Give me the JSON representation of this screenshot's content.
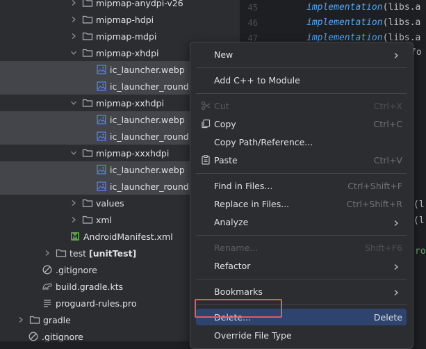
{
  "tree": {
    "rows": [
      {
        "label": "mipmap-anydpi-v26",
        "type": "folder",
        "expanded": false
      },
      {
        "label": "mipmap-hdpi",
        "type": "folder",
        "expanded": false
      },
      {
        "label": "mipmap-mdpi",
        "type": "folder",
        "expanded": false
      },
      {
        "label": "mipmap-xhdpi",
        "type": "folder",
        "expanded": true
      },
      {
        "label": "ic_launcher.webp",
        "type": "image",
        "selected": true
      },
      {
        "label": "ic_launcher_round.webp",
        "type": "image",
        "selected": true
      },
      {
        "label": "mipmap-xxhdpi",
        "type": "folder",
        "expanded": true
      },
      {
        "label": "ic_launcher.webp",
        "type": "image",
        "selected": true
      },
      {
        "label": "ic_launcher_round.webp",
        "type": "image",
        "selected": true
      },
      {
        "label": "mipmap-xxxhdpi",
        "type": "folder",
        "expanded": true
      },
      {
        "label": "ic_launcher.webp",
        "type": "image",
        "selected": true
      },
      {
        "label": "ic_launcher_round.webp",
        "type": "image",
        "selected": true
      },
      {
        "label": "values",
        "type": "folder",
        "expanded": false
      },
      {
        "label": "xml",
        "type": "folder",
        "expanded": false
      },
      {
        "label": "AndroidManifest.xml",
        "type": "manifest"
      },
      {
        "label": "test",
        "suffix": "[unitTest]",
        "type": "folder",
        "expanded": false
      },
      {
        "label": ".gitignore",
        "type": "ignore"
      },
      {
        "label": "build.gradle.kts",
        "type": "gradle"
      },
      {
        "label": "proguard-rules.pro",
        "type": "text"
      },
      {
        "label": "gradle",
        "type": "folder",
        "expanded": false
      },
      {
        "label": ".gitignore",
        "type": "ignore"
      }
    ]
  },
  "editor": {
    "line_numbers": [
      "45",
      "46",
      "47"
    ],
    "lines": [
      {
        "keyword": "implementation",
        "text": "(libs.a"
      },
      {
        "keyword": "implementation",
        "text": "(libs.a"
      },
      {
        "keyword": "implementation",
        "text": "(libs.a"
      }
    ],
    "fragments": [
      "fo",
      "(l",
      "(l",
      "ro"
    ]
  },
  "context_menu": {
    "items": [
      {
        "label": "New",
        "mnemonic": "N",
        "submenu": true
      },
      {
        "separator": true
      },
      {
        "label": "Add C++ to Module"
      },
      {
        "separator": true
      },
      {
        "label": "Cut",
        "shortcut": "Ctrl+X",
        "icon": "scissors-icon",
        "disabled": true
      },
      {
        "label": "Copy",
        "shortcut": "Ctrl+C",
        "icon": "copy-icon"
      },
      {
        "label": "Copy Path/Reference..."
      },
      {
        "label": "Paste",
        "shortcut": "Ctrl+V",
        "icon": "paste-icon"
      },
      {
        "separator": true
      },
      {
        "label": "Find in Files...",
        "shortcut": "Ctrl+Shift+F"
      },
      {
        "label": "Replace in Files...",
        "shortcut": "Ctrl+Shift+R"
      },
      {
        "label": "Analyze",
        "submenu": true
      },
      {
        "separator": true
      },
      {
        "label": "Rename...",
        "shortcut": "Shift+F6",
        "disabled": true
      },
      {
        "label": "Refactor",
        "submenu": true
      },
      {
        "separator": true
      },
      {
        "label": "Bookmarks",
        "submenu": true
      },
      {
        "separator": true
      },
      {
        "label": "Delete...",
        "shortcut": "Delete",
        "active": true
      },
      {
        "label": "Override File Type"
      }
    ]
  },
  "colors": {
    "accent": "#2e436e",
    "highlight_box": "#e35b5b",
    "folder": "#aeb3bd",
    "keyword": "#56a8f5"
  }
}
